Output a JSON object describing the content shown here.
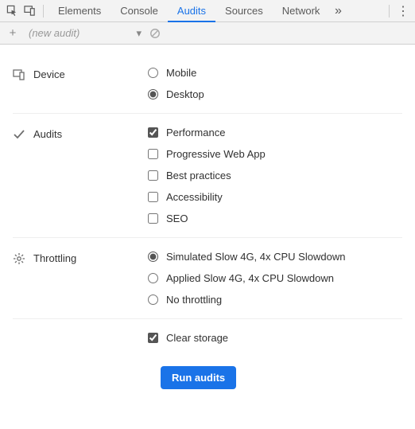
{
  "topbar": {
    "tabs": [
      "Elements",
      "Console",
      "Audits",
      "Sources",
      "Network"
    ],
    "active_tab_index": 2
  },
  "toolbar": {
    "new_audit_placeholder": "(new audit)"
  },
  "sections": {
    "device": {
      "label": "Device",
      "options": {
        "mobile": "Mobile",
        "desktop": "Desktop"
      },
      "selected": "desktop"
    },
    "audits": {
      "label": "Audits",
      "options": {
        "performance": "Performance",
        "pwa": "Progressive Web App",
        "best": "Best practices",
        "a11y": "Accessibility",
        "seo": "SEO"
      },
      "checked": [
        "performance"
      ]
    },
    "throttling": {
      "label": "Throttling",
      "options": {
        "simulated": "Simulated Slow 4G, 4x CPU Slowdown",
        "applied": "Applied Slow 4G, 4x CPU Slowdown",
        "none": "No throttling"
      },
      "selected": "simulated"
    },
    "clear_storage": {
      "label": "Clear storage",
      "checked": true
    }
  },
  "run_button": "Run audits"
}
